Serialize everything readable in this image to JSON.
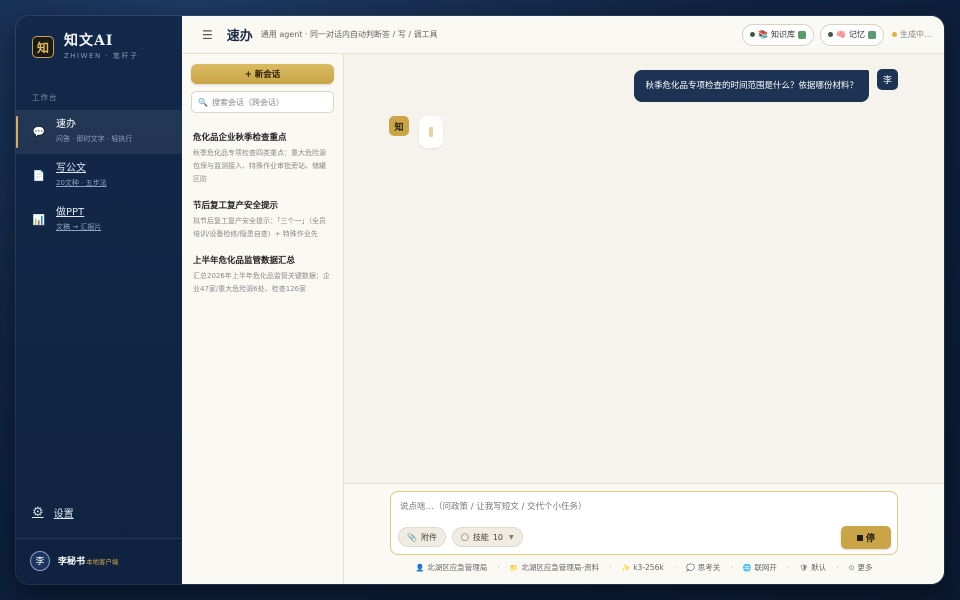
{
  "brand": {
    "logo": "知",
    "name": "知文AI",
    "subtitle": "ZHIWEN · 笔杆子"
  },
  "sidebar": {
    "section_label": "工作台",
    "items": [
      {
        "icon": "chat-bubble-icon",
        "glyph": "💬",
        "title": "速办",
        "desc": "问答 · 即时文字 · 轻执行",
        "active": true
      },
      {
        "icon": "document-icon",
        "glyph": "📄",
        "title": "写公文",
        "desc": "20文种 · 五步法",
        "active": false
      },
      {
        "icon": "presentation-icon",
        "glyph": "📊",
        "title": "做PPT",
        "desc": "文稿 → 汇报片",
        "active": false
      }
    ],
    "settings_label": "设置",
    "user": {
      "avatar": "李",
      "name": "李秘书",
      "role": "本地客户端"
    }
  },
  "topbar": {
    "title": "速办",
    "subtitle": "通用 agent · 同一对话内自动判断答 / 写 / 调工具",
    "knowledge_label": "知识库",
    "memory_label": "记忆",
    "status_label": "生成中…"
  },
  "conversations": {
    "new_label": "+ 新会话",
    "search_placeholder": "搜索会话（跨会话）",
    "items": [
      {
        "title": "危化品企业秋季检查重点",
        "snippet": "秋季危化品专项检查四类重点：重大危险源包保与监测接入、特殊作业审批旁站、储罐区防"
      },
      {
        "title": "节后复工复产安全提示",
        "snippet": "拟节后复工复产安全提示：「三个一」（全员培训/设备检修/隐患自查）+ 特殊作业先"
      },
      {
        "title": "上半年危化品监管数据汇总",
        "snippet": "汇总2026年上半年危化品监管关键数据：企业47家/重大危险源6处、检查126家"
      }
    ]
  },
  "chat": {
    "user_avatar": "李",
    "user_message": "秋季危化品专项检查的时间范围是什么？依据哪份材料？",
    "bot_avatar": "知"
  },
  "composer": {
    "placeholder": "说点啥…（问政策 / 让我写短文 / 交代个小任务）",
    "attach_label": "附件",
    "skills_label": "技能",
    "skills_count": "10",
    "stop_label": "停"
  },
  "footer": {
    "org": "北湖区应急管理局",
    "kb": "北湖区应急管理局-资料",
    "model": "k3-256k",
    "thinking": "思考关",
    "web": "联网开",
    "default": "默认",
    "more": "更多"
  },
  "colors": {
    "accent_gold": "#c9a548",
    "navy": "#1d3354",
    "sidebar_bg": "#13294a"
  }
}
